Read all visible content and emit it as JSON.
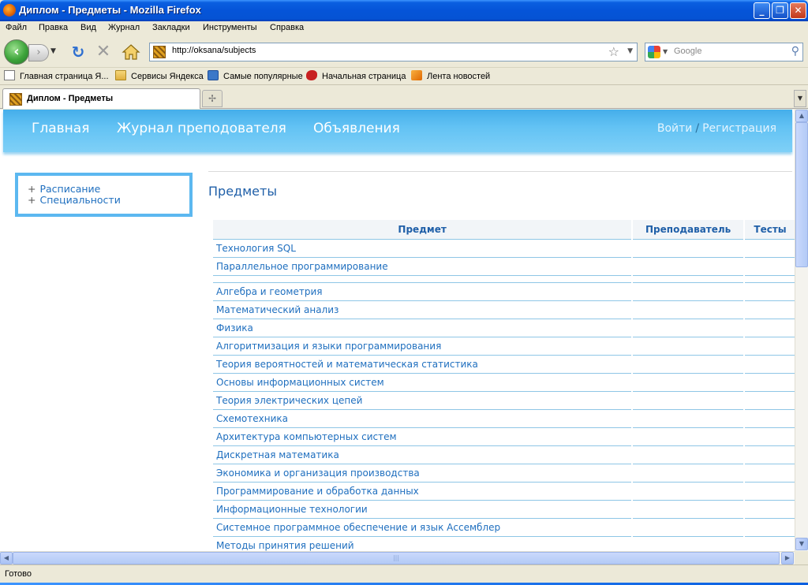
{
  "window": {
    "title": "Диплом - Предметы - Mozilla Firefox",
    "controls": {
      "minimize": "_",
      "maximize": "❐",
      "close": "✕"
    }
  },
  "menu": [
    "Файл",
    "Правка",
    "Вид",
    "Журнал",
    "Закладки",
    "Инструменты",
    "Справка"
  ],
  "navbar": {
    "url": "http://oksana/subjects",
    "search_placeholder": "Google"
  },
  "bookmarks": [
    {
      "label": "Главная страница Я...",
      "icon": "page-icon"
    },
    {
      "label": "Сервисы Яндекса",
      "icon": "folder-icon"
    },
    {
      "label": "Самые популярные",
      "icon": "popular-icon"
    },
    {
      "label": "Начальная страница",
      "icon": "start-page-icon"
    },
    {
      "label": "Лента новостей",
      "icon": "rss-icon"
    }
  ],
  "tab": {
    "label": "Диплом - Предметы"
  },
  "site": {
    "nav": [
      "Главная",
      "Журнал преподователя",
      "Объявления"
    ],
    "login": "Войти",
    "separator": "/",
    "register": "Регистрация"
  },
  "sidebar": {
    "items": [
      {
        "bullet": "+",
        "label": "Расписание"
      },
      {
        "bullet": "+",
        "label": "Специальности"
      }
    ]
  },
  "main": {
    "title": "Предметы",
    "table": {
      "headers": [
        "Предмет",
        "Преподаватель",
        "Тесты"
      ],
      "rows": [
        "Технология SQL",
        "Параллельное программирование",
        "",
        "Алгебра и геометрия",
        "Математический анализ",
        "Физика",
        "Алгоритмизация и языки программирования",
        "Теория вероятностей и математическая статистика",
        "Основы информационных систем",
        "Теория электрических цепей",
        "Схемотехника",
        "Архитектура компьютерных систем",
        "Дискретная математика",
        "Экономика и организация производства",
        "Программирование и обработка данных",
        "Информационные технологии",
        "Системное программное обеспечение и язык Ассемблер",
        "Методы принятия решений"
      ]
    }
  },
  "status": {
    "text": "Готово"
  },
  "colors": {
    "header": "#62C2F4",
    "link": "#1F6FBF",
    "title": "#1F5FA8",
    "border": "#5CB8F0"
  }
}
